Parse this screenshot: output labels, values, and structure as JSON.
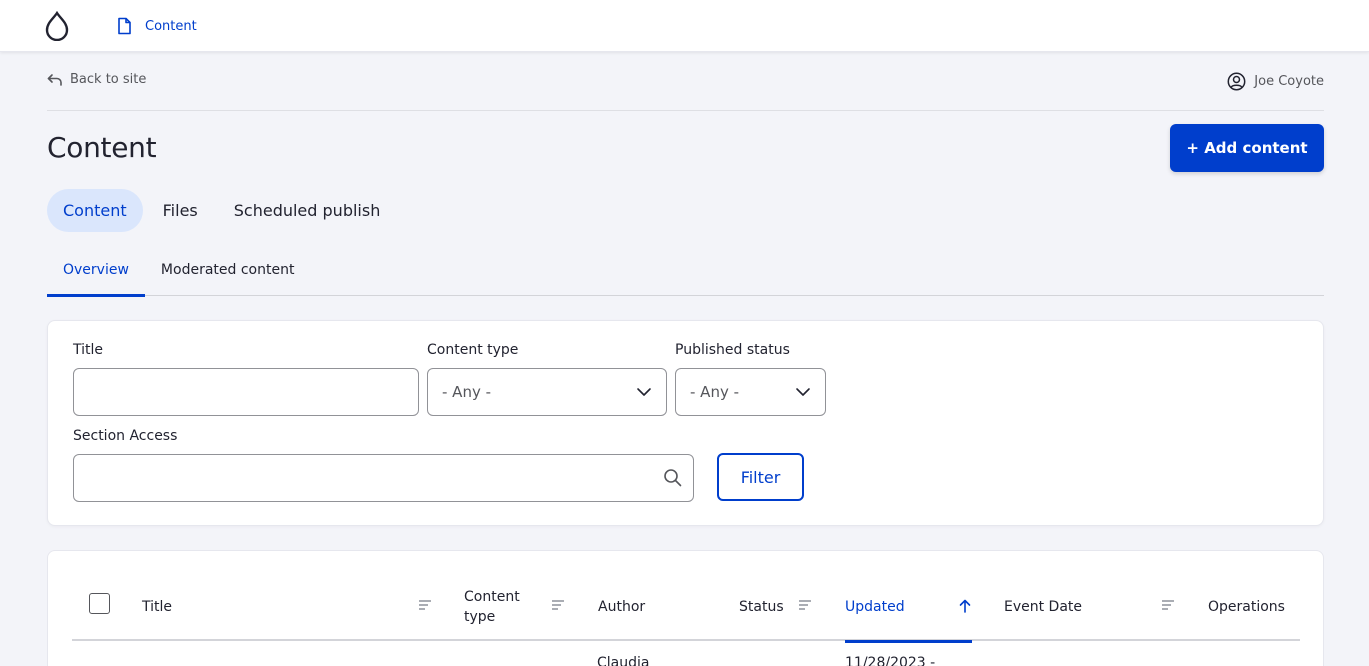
{
  "toolbar": {
    "logo_icon": "drupal-drop-icon",
    "breadcrumb": {
      "icon": "document-icon",
      "label": "Content"
    }
  },
  "header": {
    "back_link": {
      "icon": "back-arrow-icon",
      "label": "Back to site"
    },
    "user": {
      "icon": "user-circle-icon",
      "name": "Joe Coyote"
    }
  },
  "page": {
    "title": "Content",
    "add_button": "+ Add content"
  },
  "primary_tabs": [
    {
      "label": "Content",
      "active": true
    },
    {
      "label": "Files",
      "active": false
    },
    {
      "label": "Scheduled publish",
      "active": false
    }
  ],
  "secondary_tabs": [
    {
      "label": "Overview",
      "active": true
    },
    {
      "label": "Moderated content",
      "active": false
    }
  ],
  "filters": {
    "title": {
      "label": "Title",
      "value": ""
    },
    "content_type": {
      "label": "Content type",
      "value": "- Any -"
    },
    "published_status": {
      "label": "Published status",
      "value": "- Any -"
    },
    "section_access": {
      "label": "Section Access",
      "value": ""
    },
    "filter_button": "Filter"
  },
  "table": {
    "columns": [
      {
        "label": "Title",
        "sortable": true
      },
      {
        "label": "Content type",
        "sortable": true
      },
      {
        "label": "Author",
        "sortable": false
      },
      {
        "label": "Status",
        "sortable": true
      },
      {
        "label": "Updated",
        "sortable": true,
        "sorted": "asc"
      },
      {
        "label": "Event Date",
        "sortable": true
      },
      {
        "label": "Operations",
        "sortable": false
      }
    ],
    "rows": [
      {
        "author": "Claudia",
        "updated": "11/28/2023 -"
      }
    ]
  },
  "colors": {
    "accent": "#003ecc",
    "active_tab_bg": "#dae6fc",
    "page_bg": "#f3f4f9"
  }
}
